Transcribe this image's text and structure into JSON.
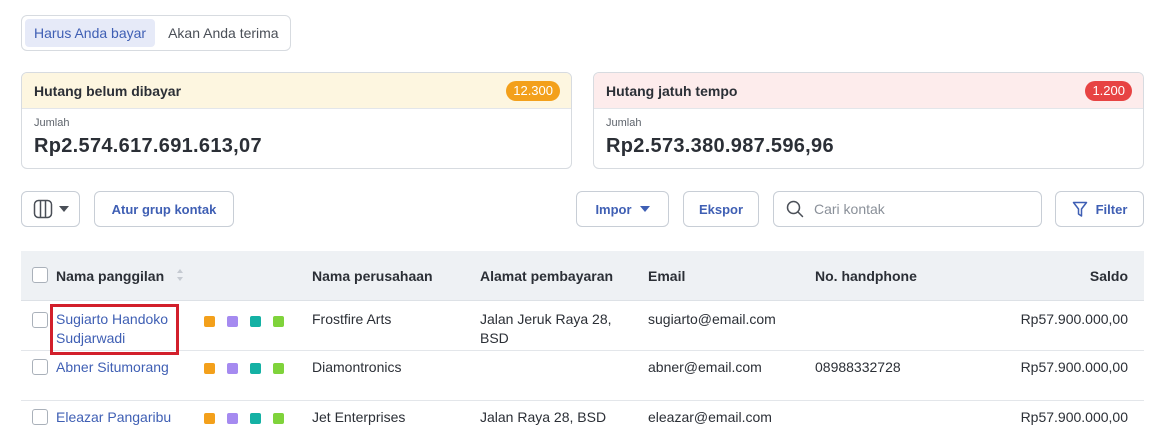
{
  "tabs": [
    {
      "label": "Harus Anda bayar",
      "active": true
    },
    {
      "label": "Akan Anda terima",
      "active": false
    }
  ],
  "cards": [
    {
      "title": "Hutang belum dibayar",
      "badge": "12.300",
      "badge_color": "#f3a01b",
      "label": "Jumlah",
      "amount": "Rp2.574.617.691.613,07"
    },
    {
      "title": "Hutang jatuh tempo",
      "badge": "1.200",
      "badge_color": "#e74343",
      "label": "Jumlah",
      "amount": "Rp2.573.380.987.596,96"
    }
  ],
  "toolbar": {
    "group_label": "Atur grup kontak",
    "import_label": "Impor",
    "export_label": "Ekspor",
    "search_placeholder": "Cari kontak",
    "filter_label": "Filter"
  },
  "table": {
    "headers": [
      "Nama panggilan",
      "Nama perusahaan",
      "Alamat pembayaran",
      "Email",
      "No. handphone",
      "Saldo"
    ],
    "tag_colors": [
      "#f3a01b",
      "#a58af0",
      "#14b1a4",
      "#7fd33b"
    ],
    "rows": [
      {
        "name_line1": "Sugiarto Handoko",
        "name_line2": "Sudjarwadi",
        "company": "Frostfire Arts",
        "address_line1": "Jalan Jeruk Raya 28,",
        "address_line2": "BSD",
        "email": "sugiarto@email.com",
        "phone": "",
        "saldo": "Rp57.900.000,00"
      },
      {
        "name_line1": "Abner Situmorang",
        "name_line2": "",
        "company": "Diamontronics",
        "address_line1": "",
        "address_line2": "",
        "email": "abner@email.com",
        "phone": "08988332728",
        "saldo": "Rp57.900.000,00"
      },
      {
        "name_line1": "Eleazar Pangaribu",
        "name_line2": "",
        "company": "Jet Enterprises",
        "address_line1": "Jalan Raya 28, BSD",
        "address_line2": "",
        "email": "eleazar@email.com",
        "phone": "",
        "saldo": "Rp57.900.000,00"
      }
    ]
  },
  "colors": {
    "accent": "#3f5fb4",
    "highlight": "#d21f2b"
  }
}
